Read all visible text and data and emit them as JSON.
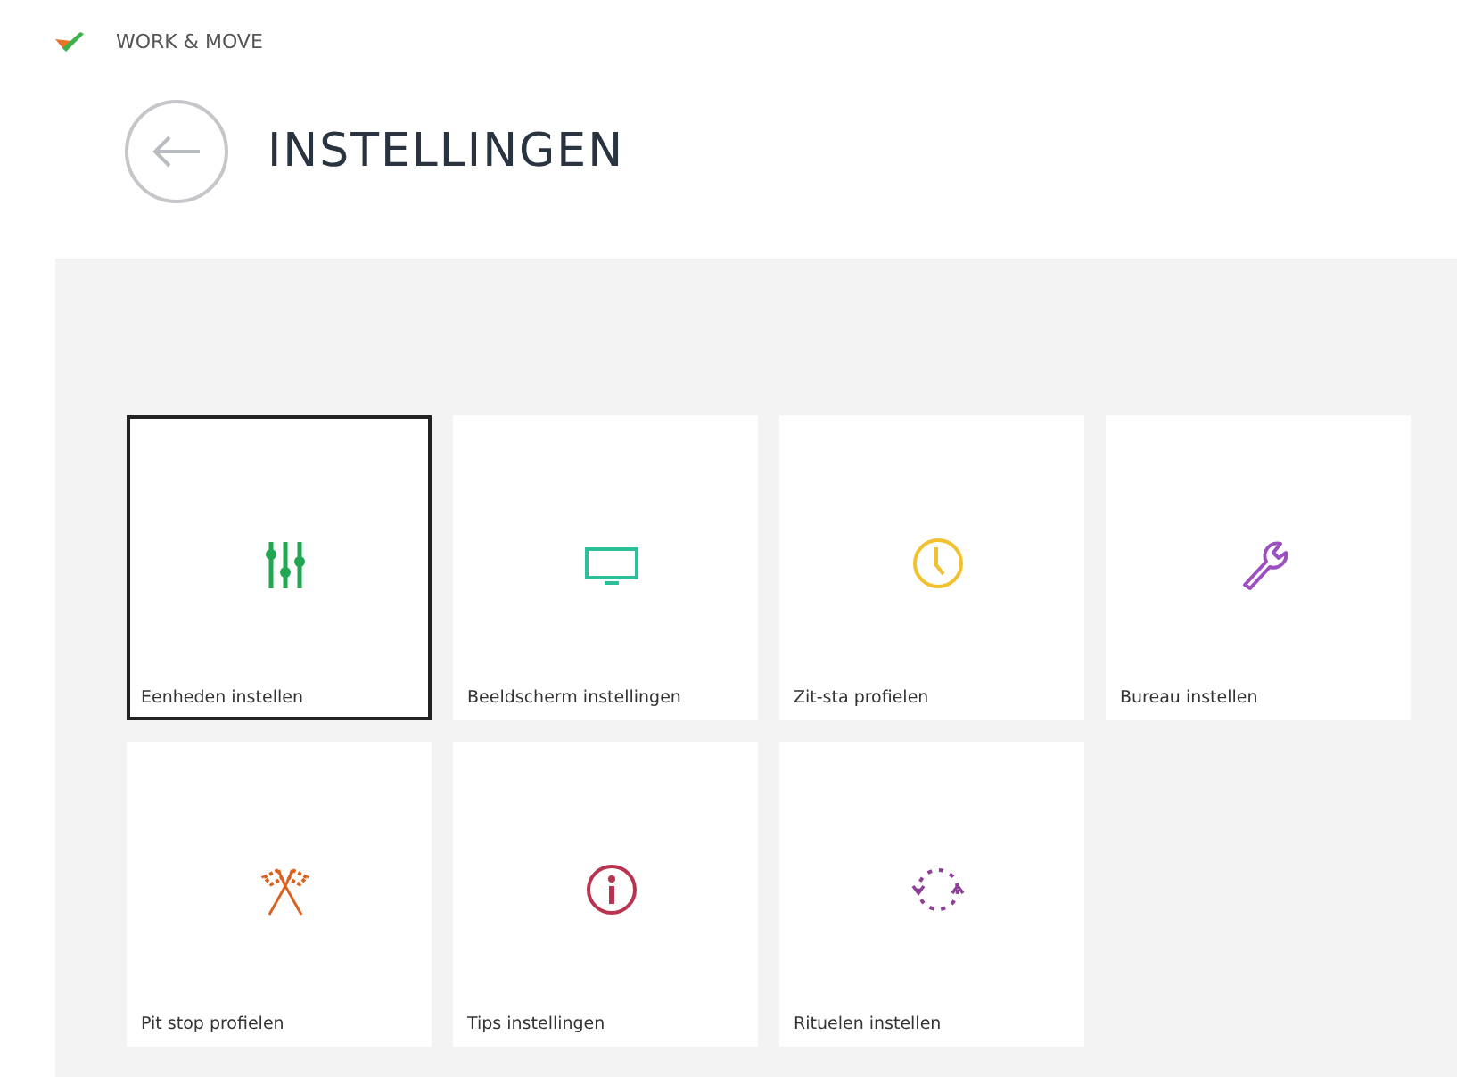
{
  "app": {
    "name": "WORK & MOVE"
  },
  "page": {
    "title": "INSTELLINGEN"
  },
  "tiles": [
    {
      "label": "Eenheden instellen",
      "kind": "sliders",
      "color": "#22a652",
      "selected": true
    },
    {
      "label": "Beeldscherm instellingen",
      "kind": "monitor",
      "color": "#2bbf9a",
      "selected": false
    },
    {
      "label": "Zit-sta profielen",
      "kind": "clock",
      "color": "#f2c12e",
      "selected": false
    },
    {
      "label": "Bureau instellen",
      "kind": "wrench",
      "color": "#9b4fc0",
      "selected": false
    },
    {
      "label": "Pit stop profielen",
      "kind": "flags",
      "color": "#d9621e",
      "selected": false
    },
    {
      "label": "Tips instellingen",
      "kind": "info",
      "color": "#b8334f",
      "selected": false
    },
    {
      "label": "Rituelen instellen",
      "kind": "cycle",
      "color": "#8e3f96",
      "selected": false
    }
  ]
}
